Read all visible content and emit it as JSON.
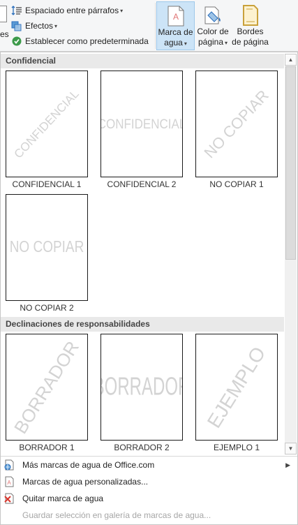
{
  "ribbon": {
    "partial_label": "es",
    "paragraph_spacing": "Espaciado entre párrafos",
    "effects": "Efectos",
    "set_default": "Establecer como predeterminada",
    "watermark_line1": "Marca de",
    "watermark_line2": "agua",
    "page_color_line1": "Color de",
    "page_color_line2": "página",
    "page_borders_line1": "Bordes",
    "page_borders_line2": "de página"
  },
  "sections": [
    {
      "title": "Confidencial",
      "items": [
        {
          "caption": "CONFIDENCIAL 1",
          "watermark": "CONFIDENCIAL",
          "orientation": "diagonal"
        },
        {
          "caption": "CONFIDENCIAL 2",
          "watermark": "CONFIDENCIAL",
          "orientation": "horizontal"
        },
        {
          "caption": "NO COPIAR 1",
          "watermark": "NO COPIAR",
          "orientation": "diagonal"
        },
        {
          "caption": "NO COPIAR 2",
          "watermark": "NO COPIAR",
          "orientation": "horizontal"
        }
      ]
    },
    {
      "title": "Declinaciones de responsabilidades",
      "items": [
        {
          "caption": "BORRADOR 1",
          "watermark": "BORRADOR",
          "orientation": "diagonal"
        },
        {
          "caption": "BORRADOR 2",
          "watermark": "BORRADOR",
          "orientation": "horizontal"
        },
        {
          "caption": "EJEMPLO 1",
          "watermark": "EJEMPLO",
          "orientation": "diagonal"
        }
      ]
    }
  ],
  "menu": [
    {
      "label": "Más marcas de agua de Office.com",
      "icon": "office-watermark-icon",
      "submenu": true,
      "enabled": true
    },
    {
      "label": "Marcas de agua personalizadas...",
      "icon": "custom-watermark-icon",
      "submenu": false,
      "enabled": true
    },
    {
      "label": "Quitar marca de agua",
      "icon": "remove-watermark-icon",
      "submenu": false,
      "enabled": true
    },
    {
      "label": "Guardar selección en galería de marcas de agua...",
      "icon": "save-to-gallery-icon",
      "submenu": false,
      "enabled": false
    }
  ],
  "colors": {
    "active_button": "#cce4f7",
    "section_header": "#e9e9e9",
    "watermark_text": "#d3d3d3",
    "disabled_text": "#a6a6a6"
  }
}
